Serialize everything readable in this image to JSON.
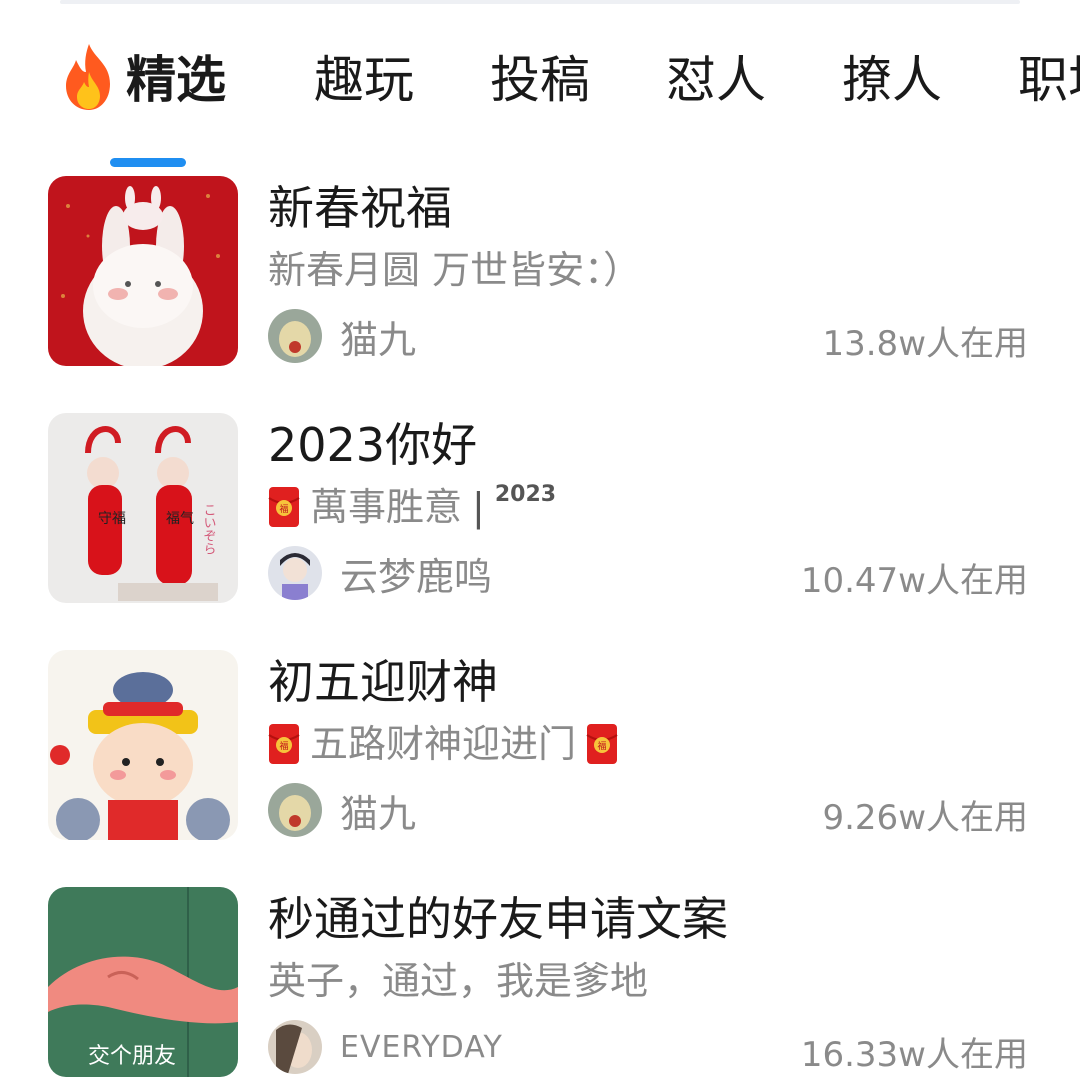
{
  "tabs": [
    {
      "label": "精选",
      "active": true,
      "icon": "fire-icon"
    },
    {
      "label": "趣玩"
    },
    {
      "label": "投稿"
    },
    {
      "label": "怼人"
    },
    {
      "label": "撩人"
    },
    {
      "label": "职场"
    }
  ],
  "accent_color": "#1f8ef1",
  "items": [
    {
      "title": "新春祝福",
      "subtitle": "新春月圆 万世皆安：）",
      "author": "猫九",
      "usage": "13.8w人在用",
      "thumb_icon": "rabbit-thumbnail"
    },
    {
      "title": "2023你好",
      "subtitle_icon": "red-envelope-icon",
      "subtitle": "萬事胜意",
      "subtitle_sep": "|",
      "subtitle_tag": "2023",
      "author": "云梦鹿鸣",
      "usage": "10.47w人在用",
      "thumb_icon": "couplet-thumbnail"
    },
    {
      "title": "初五迎财神",
      "subtitle_icon": "red-envelope-icon",
      "subtitle": "五路财神迎进门",
      "author": "猫九",
      "usage": "9.26w人在用",
      "thumb_icon": "fortune-god-thumbnail"
    },
    {
      "title": "秒通过的好友申请文案",
      "subtitle": "英子，通过，我是爹地",
      "author": "EVERYDAY",
      "usage": "16.33w人在用",
      "thumb_icon": "patrick-hand-thumbnail",
      "thumb_caption": "交个朋友"
    }
  ]
}
